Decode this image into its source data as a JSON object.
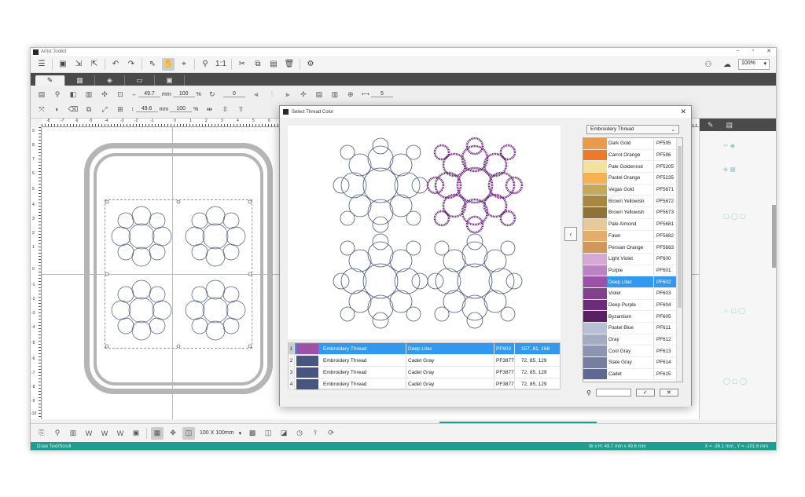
{
  "app": {
    "title": "Artist Toolkit",
    "window_controls": [
      "–",
      "▫",
      "✕"
    ]
  },
  "toolbar": {
    "zoom": "100%"
  },
  "fields": {
    "width": "49.7",
    "width_unit": "mm",
    "width_pct": "100",
    "height": "49.6",
    "height_unit": "mm",
    "height_pct": "100",
    "rotation": "0",
    "repeat": "5"
  },
  "ruler": {
    "h_labels": [
      "-8",
      "-7",
      "-6",
      "-5",
      "-4",
      "-3",
      "-2",
      "-1",
      "0",
      "1",
      "2",
      "3",
      "4",
      "5",
      "6"
    ],
    "v_labels": [
      "9",
      "8",
      "7",
      "6",
      "5",
      "4",
      "3",
      "2",
      "1",
      "0",
      "-1",
      "-2",
      "-3",
      "-4",
      "-5",
      "-6",
      "-7",
      "-8",
      "-9",
      "-10"
    ]
  },
  "bottom": {
    "hoop": "100 X 100mm"
  },
  "status": {
    "left": "Draw Text/Scroll",
    "mid": "W x H: 49.7 mm x 49.6 mm",
    "right": "X = -36.1 mm ,  Y = -101.6 mm"
  },
  "dialog": {
    "title": "Select Thread Color",
    "brand": "Embroidery Thread",
    "rows": [
      {
        "n": "1",
        "brand": "Embroidery Thread",
        "name": "Deep Lilac",
        "code": "PF602",
        "rgb": "157, 81, 168",
        "color": "#9d51a8"
      },
      {
        "n": "2",
        "brand": "Embroidery Thread",
        "name": "Cadet Gray",
        "code": "PF3877",
        "rgb": "72, 85, 129",
        "color": "#485581"
      },
      {
        "n": "3",
        "brand": "Embroidery Thread",
        "name": "Cadet Gray",
        "code": "PF3877",
        "rgb": "72, 85, 129",
        "color": "#485581"
      },
      {
        "n": "4",
        "brand": "Embroidery Thread",
        "name": "Cadet Gray",
        "code": "PF3877",
        "rgb": "72, 85, 129",
        "color": "#485581"
      }
    ],
    "threads": [
      {
        "name": "Dark Gold",
        "code": "PF595",
        "color": "#e99a4a"
      },
      {
        "name": "Carrot Orange",
        "code": "PF596",
        "color": "#ec7a2a"
      },
      {
        "name": "Pale Goldenrod",
        "code": "PF5205",
        "color": "#f3e1a1"
      },
      {
        "name": "Pastel Orange",
        "code": "PF5235",
        "color": "#f5b153"
      },
      {
        "name": "Vegas Gold",
        "code": "PF5671",
        "color": "#c6a859"
      },
      {
        "name": "Brown Yellowish",
        "code": "PF5672",
        "color": "#a88840"
      },
      {
        "name": "Brown Yellowish",
        "code": "PF5673",
        "color": "#8e7238"
      },
      {
        "name": "Pale Almond",
        "code": "PF5681",
        "color": "#e8c99a"
      },
      {
        "name": "Fawn",
        "code": "PF5682",
        "color": "#e4ad6c"
      },
      {
        "name": "Persian Orange",
        "code": "PF5683",
        "color": "#d2955a"
      },
      {
        "name": "Light Violet",
        "code": "PF600",
        "color": "#d5a9d6"
      },
      {
        "name": "Purple",
        "code": "PF601",
        "color": "#bb82c4"
      },
      {
        "name": "Deep Lilac",
        "code": "PF602",
        "color": "#9d51a8"
      },
      {
        "name": "Violet",
        "code": "PF603",
        "color": "#82408e"
      },
      {
        "name": "Deep Purple",
        "code": "PF604",
        "color": "#6c2c7a"
      },
      {
        "name": "Byzantium",
        "code": "PF605",
        "color": "#5a1f62"
      },
      {
        "name": "Pastel Blue",
        "code": "PF611",
        "color": "#b7bfd6"
      },
      {
        "name": "Gray",
        "code": "PF612",
        "color": "#a4acc4"
      },
      {
        "name": "Cool Gray",
        "code": "PF613",
        "color": "#8c95b3"
      },
      {
        "name": "Slate Gray",
        "code": "PF614",
        "color": "#767fa2"
      },
      {
        "name": "Cadet",
        "code": "PF615",
        "color": "#5f6890"
      }
    ],
    "ok": "✓",
    "cancel": "✕"
  }
}
